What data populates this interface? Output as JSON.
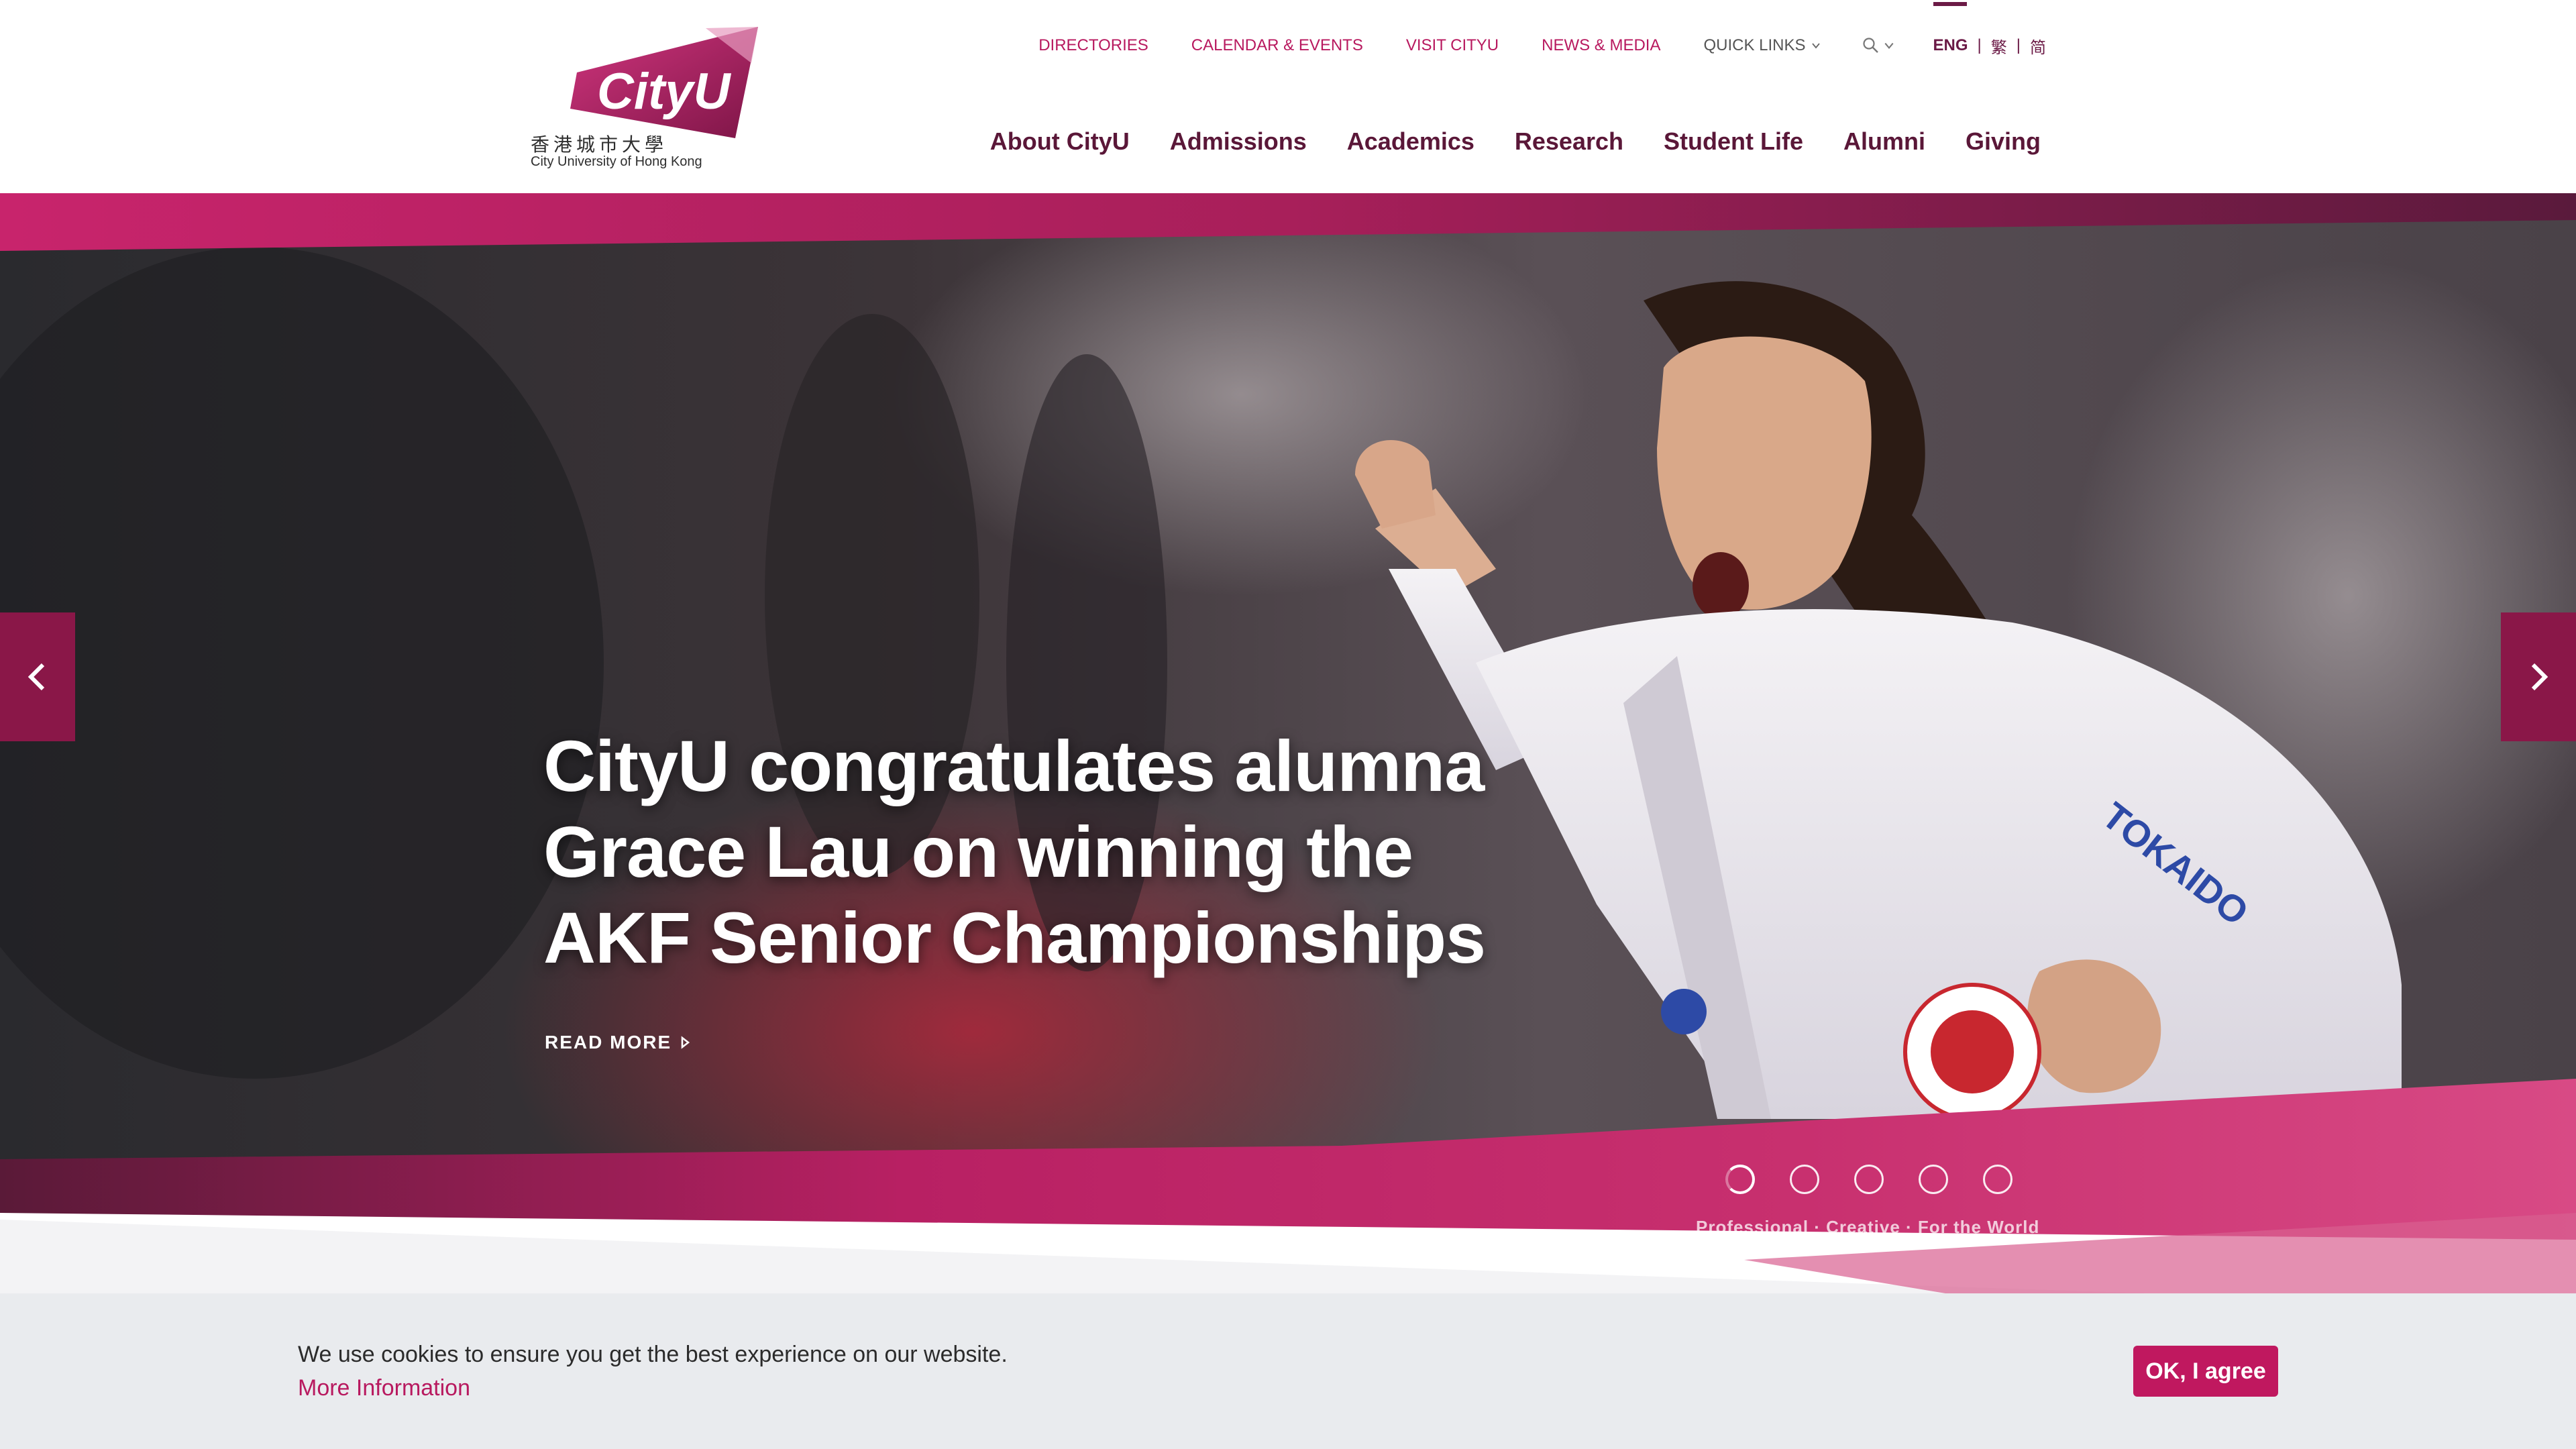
{
  "brand": {
    "logo_text": "CityU",
    "chinese_name": "香港城市大學",
    "english_name": "City University of Hong Kong"
  },
  "utility_nav": {
    "links": [
      "DIRECTORIES",
      "CALENDAR & EVENTS",
      "VISIT CITYU",
      "NEWS & MEDIA"
    ],
    "quick_links": "QUICK LINKS",
    "search_icon": "search-icon",
    "languages": [
      "ENG",
      "繁",
      "简"
    ],
    "active_language": "ENG"
  },
  "main_nav": [
    "About CityU",
    "Admissions",
    "Academics",
    "Research",
    "Student Life",
    "Alumni",
    "Giving"
  ],
  "hero": {
    "title": "CityU congratulates alumna Grace Lau on winning the AKF Senior Championships",
    "cta": "READ MORE",
    "slide_count": 5,
    "active_slide": 1,
    "tagline": "Professional · Creative · For the World",
    "prev_icon": "chevron-left-icon",
    "next_icon": "chevron-right-icon"
  },
  "cookie_banner": {
    "message": "We use cookies to ensure you get the best experience on our website.",
    "more_link": "More Information",
    "agree_button": "OK, I agree"
  },
  "colors": {
    "brand_magenta": "#c0185f",
    "brand_plum": "#5a1738",
    "cookie_bg": "#e9ebee"
  }
}
